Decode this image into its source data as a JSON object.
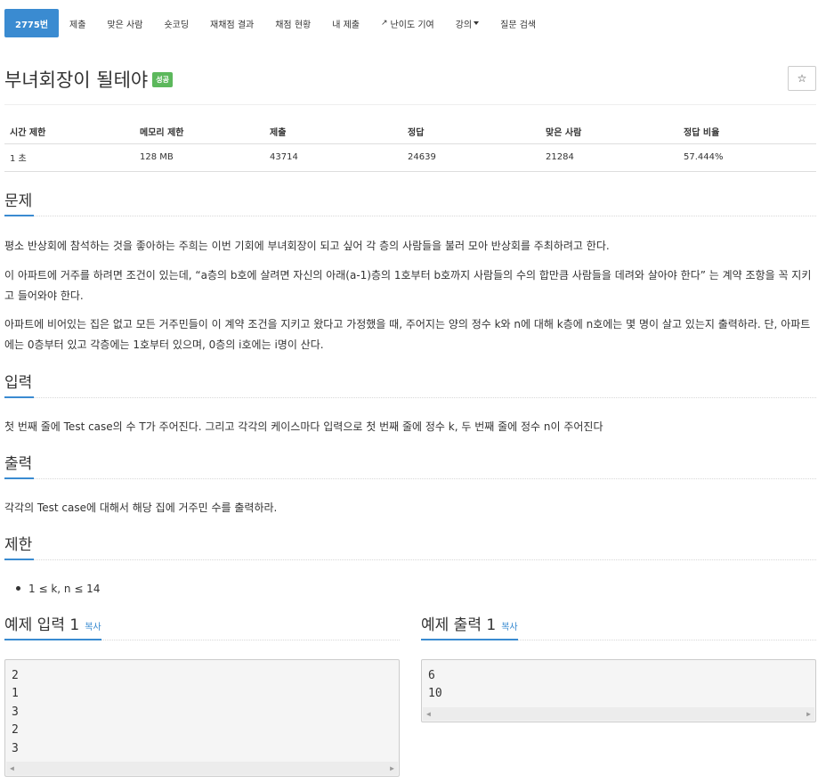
{
  "nav": {
    "problem_number": "2775번",
    "tabs": [
      "제출",
      "맞은 사람",
      "숏코딩",
      "재채점 결과",
      "채점 현황",
      "내 제출"
    ],
    "contribute_label": "난이도 기여",
    "lecture_label": "강의",
    "question_label": "질문 검색"
  },
  "problem": {
    "title": "부녀회장이 될테야",
    "status_badge": "성공",
    "star_icon": "☆"
  },
  "info_table": {
    "headers": [
      "시간 제한",
      "메모리 제한",
      "제출",
      "정답",
      "맞은 사람",
      "정답 비율"
    ],
    "values": [
      "1 초",
      "128 MB",
      "43714",
      "24639",
      "21284",
      "57.444%"
    ]
  },
  "sections": {
    "description_heading": "문제",
    "description_p1": "평소 반상회에 참석하는 것을 좋아하는 주희는 이번 기회에 부녀회장이 되고 싶어 각 층의 사람들을 불러 모아 반상회를 주최하려고 한다.",
    "description_p2": "이 아파트에 거주를 하려면 조건이 있는데, “a층의 b호에 살려면 자신의 아래(a-1)층의 1호부터 b호까지 사람들의 수의 합만큼 사람들을 데려와 살아야 한다” 는 계약 조항을 꼭 지키고 들어와야 한다.",
    "description_p3": "아파트에 비어있는 집은 없고 모든 거주민들이 이 계약 조건을 지키고 왔다고 가정했을 때, 주어지는 양의 정수 k와 n에 대해 k층에 n호에는 몇 명이 살고 있는지 출력하라. 단, 아파트에는 0층부터 있고 각층에는 1호부터 있으며, 0층의 i호에는 i명이 산다.",
    "input_heading": "입력",
    "input_text": "첫 번째 줄에 Test case의 수 T가 주어진다. 그리고 각각의 케이스마다 입력으로 첫 번째 줄에 정수 k, 두 번째 줄에 정수 n이 주어진다",
    "output_heading": "출력",
    "output_text": "각각의 Test case에 대해서 해당 집에 거주민 수를 출력하라.",
    "limit_heading": "제한",
    "limit_item": "1 ≤ k, n ≤ 14"
  },
  "samples": {
    "input_heading": "예제 입력 1",
    "output_heading": "예제 출력 1",
    "copy_label": "복사",
    "input_text": "2\n1\n3\n2\n3",
    "output_text": "6\n10"
  }
}
